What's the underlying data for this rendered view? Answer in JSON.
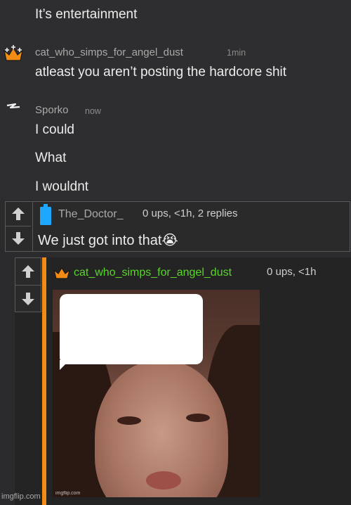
{
  "chat": {
    "messages": [
      {
        "text": "It’s entertainment"
      },
      {
        "user": "cat_who_simps_for_angel_dust",
        "time": "1min",
        "text": "atleast you aren’t posting the hardcore shit",
        "badge": "crown-icon",
        "badge_color": "#f28c14"
      },
      {
        "user": "Sporko",
        "time": "now",
        "lines": [
          "I could",
          "What",
          "I wouldnt"
        ],
        "badge": "lightning-icon"
      }
    ]
  },
  "comment": {
    "user": "The_Doctor_",
    "meta": "0 ups, <1h, 2 replies",
    "text": "We just got into that",
    "emoji": "😭",
    "badge": "battery-icon",
    "badge_color": "#1ea7ff"
  },
  "reply": {
    "user": "cat_who_simps_for_angel_dust",
    "meta": "0 ups, <1h",
    "badge": "crown-icon",
    "user_color": "#58d62a",
    "accent": "#f28c14",
    "image_watermark": "imgflip.com"
  },
  "footer": {
    "watermark": "imgflip.com"
  }
}
